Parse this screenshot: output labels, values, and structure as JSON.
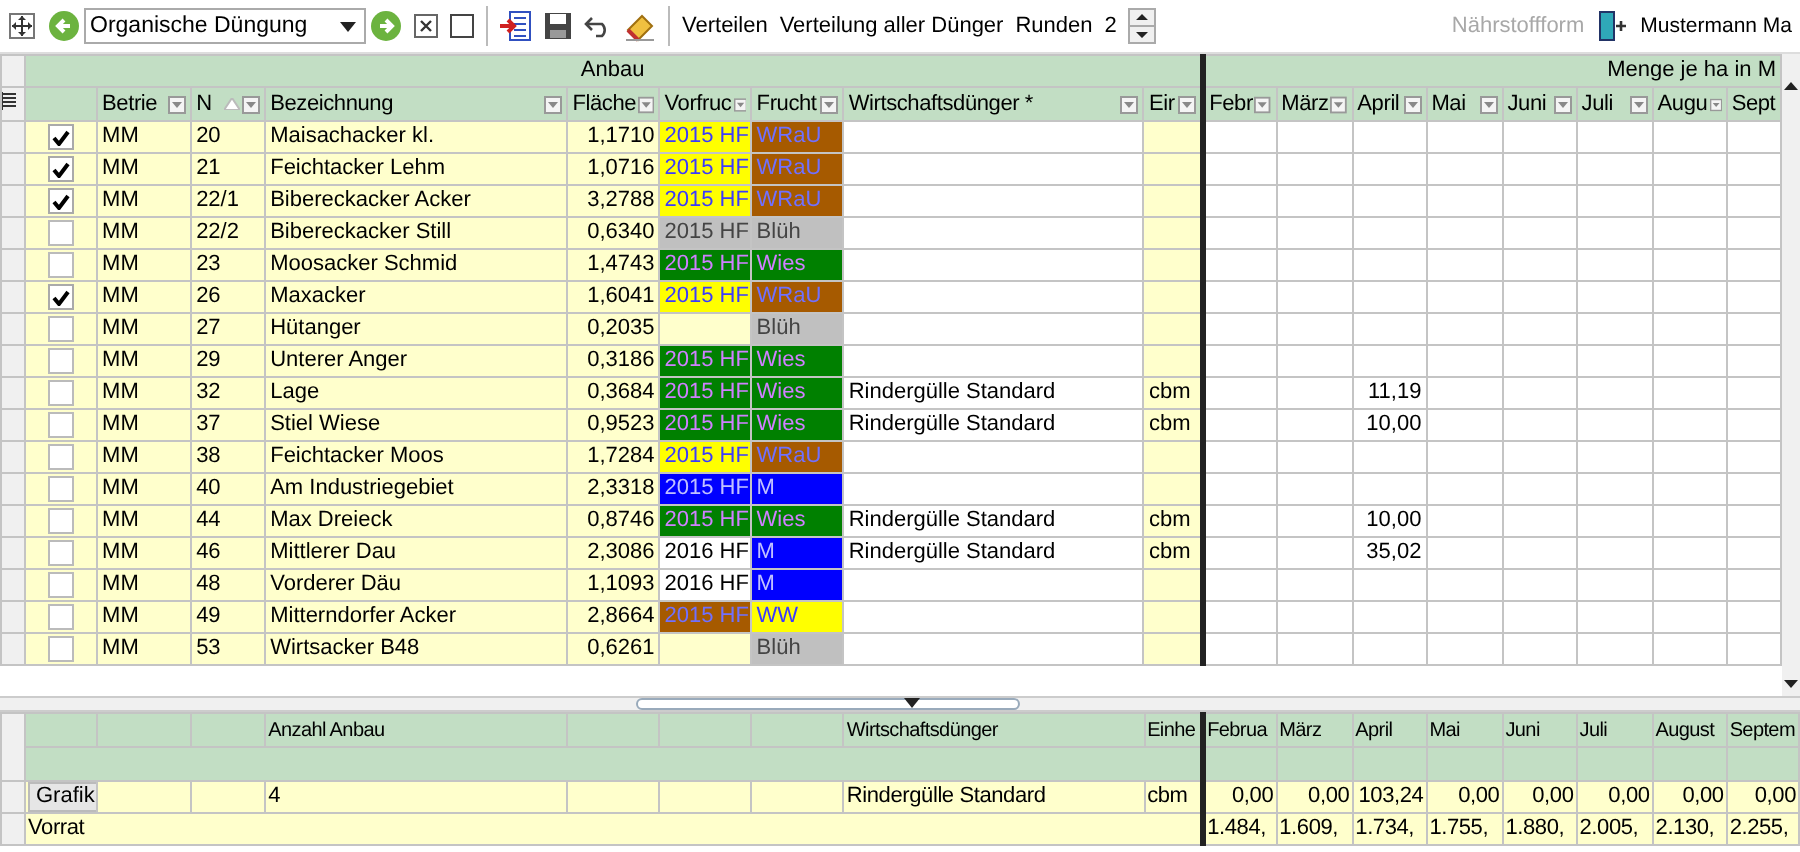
{
  "toolbar": {
    "dropdown": {
      "value": "Organische Düngung"
    },
    "actions": [
      "Verteilen",
      "Verteilung aller Dünger"
    ],
    "rounding": {
      "label": "Runden",
      "value": "2"
    },
    "nutrient_form": {
      "label": "Nährstoffform",
      "disabled": true
    },
    "user": "Mustermann Ma"
  },
  "grid": {
    "group_headers": [
      "Anbau",
      "Menge je ha in M"
    ],
    "columns": [
      {
        "label": "Betrie",
        "sorted": false
      },
      {
        "label": "N",
        "sorted": true
      },
      {
        "label": "Bezeichnung",
        "sorted": false
      },
      {
        "label": "Fläche",
        "sorted": false
      },
      {
        "label": "Vorfruc",
        "sorted": false
      },
      {
        "label": "Frucht",
        "sorted": false
      },
      {
        "label": "Wirtschaftsdünger *",
        "sorted": false
      },
      {
        "label": "Eir",
        "sorted": false
      }
    ],
    "month_columns": [
      "Febr",
      "März",
      "April",
      "Mai",
      "Juni",
      "Juli",
      "Augu",
      "Sept"
    ],
    "rows": [
      {
        "checked": true,
        "farm": "MM",
        "number": "20",
        "name": "Maisachacker kl.",
        "area": "1,1710",
        "previous_crop": {
          "text": "2015 HF",
          "color": "#ffff00"
        },
        "crop": {
          "text": "WRaU",
          "color": "#a65a00"
        }
      },
      {
        "checked": true,
        "farm": "MM",
        "number": "21",
        "name": "Feichtacker Lehm",
        "area": "1,0716",
        "previous_crop": {
          "text": "2015 HF",
          "color": "#ffff00"
        },
        "crop": {
          "text": "WRaU",
          "color": "#a65a00"
        }
      },
      {
        "checked": true,
        "farm": "MM",
        "number": "22/1",
        "name": "Bibereckacker Acker",
        "area": "3,2788",
        "previous_crop": {
          "text": "2015 HF",
          "color": "#ffff00"
        },
        "crop": {
          "text": "WRaU",
          "color": "#a65a00"
        }
      },
      {
        "checked": false,
        "farm": "MM",
        "number": "22/2",
        "name": "Bibereckacker Still",
        "area": "0,6340",
        "previous_crop": {
          "text": "2015 HF",
          "color": "#c0c0c0"
        },
        "crop": {
          "text": "Blüh",
          "color": "#c0c0c0"
        }
      },
      {
        "checked": false,
        "farm": "MM",
        "number": "23",
        "name": "Moosacker Schmid",
        "area": "1,4743",
        "previous_crop": {
          "text": "2015 HF",
          "color": "#008000"
        },
        "crop": {
          "text": "Wies",
          "color": "#008000"
        }
      },
      {
        "checked": true,
        "farm": "MM",
        "number": "26",
        "name": "Maxacker",
        "area": "1,6041",
        "previous_crop": {
          "text": "2015 HF",
          "color": "#ffff00"
        },
        "crop": {
          "text": "WRaU",
          "color": "#a65a00"
        }
      },
      {
        "checked": false,
        "farm": "MM",
        "number": "27",
        "name": "Hütanger",
        "area": "0,2035",
        "crop": {
          "text": "Blüh",
          "color": "#c0c0c0"
        }
      },
      {
        "checked": false,
        "farm": "MM",
        "number": "29",
        "name": "Unterer Anger",
        "area": "0,3186",
        "previous_crop": {
          "text": "2015 HF",
          "color": "#008000"
        },
        "crop": {
          "text": "Wies",
          "color": "#008000"
        }
      },
      {
        "checked": false,
        "farm": "MM",
        "number": "32",
        "name": "Lage",
        "area": "0,3684",
        "previous_crop": {
          "text": "2015 HF",
          "color": "#008000"
        },
        "crop": {
          "text": "Wies",
          "color": "#008000"
        },
        "fertilizer": "Rindergülle Standard",
        "unit": "cbm",
        "amounts": {
          "april": "11,19"
        }
      },
      {
        "checked": false,
        "farm": "MM",
        "number": "37",
        "name": "Stiel Wiese",
        "area": "0,9523",
        "previous_crop": {
          "text": "2015 HF",
          "color": "#008000"
        },
        "crop": {
          "text": "Wies",
          "color": "#008000"
        },
        "fertilizer": "Rindergülle Standard",
        "unit": "cbm",
        "amounts": {
          "april": "10,00"
        }
      },
      {
        "checked": false,
        "farm": "MM",
        "number": "38",
        "name": "Feichtacker Moos",
        "area": "1,7284",
        "previous_crop": {
          "text": "2015 HF",
          "color": "#ffff00"
        },
        "crop": {
          "text": "WRaU",
          "color": "#a65a00"
        }
      },
      {
        "checked": false,
        "farm": "MM",
        "number": "40",
        "name": "Am Industriegebiet",
        "area": "2,3318",
        "previous_crop": {
          "text": "2015 HF",
          "color": "#0000ff"
        },
        "crop": {
          "text": "M",
          "color": "#0000ff"
        }
      },
      {
        "checked": false,
        "farm": "MM",
        "number": "44",
        "name": "Max Dreieck",
        "area": "0,8746",
        "previous_crop": {
          "text": "2015 HF",
          "color": "#008000"
        },
        "crop": {
          "text": "Wies",
          "color": "#008000"
        },
        "fertilizer": "Rindergülle Standard",
        "unit": "cbm",
        "amounts": {
          "april": "10,00"
        }
      },
      {
        "checked": false,
        "farm": "MM",
        "number": "46",
        "name": "Mittlerer  Dau",
        "area": "2,3086",
        "previous_crop": {
          "text": "2016 HF"
        },
        "crop": {
          "text": "M",
          "color": "#0000ff"
        },
        "fertilizer": "Rindergülle Standard",
        "unit": "cbm",
        "amounts": {
          "april": "35,02"
        }
      },
      {
        "checked": false,
        "farm": "MM",
        "number": "48",
        "name": "Vorderer Däu",
        "area": "1,1093",
        "previous_crop": {
          "text": "2016 HF"
        },
        "crop": {
          "text": "M",
          "color": "#0000ff"
        }
      },
      {
        "checked": false,
        "farm": "MM",
        "number": "49",
        "name": "Mitterndorfer Acker",
        "area": "2,8664",
        "previous_crop": {
          "text": "2015 HF",
          "color": "#a65a00"
        },
        "crop": {
          "text": "WW",
          "color": "#ffff00"
        }
      },
      {
        "checked": false,
        "farm": "MM",
        "number": "53",
        "name": "Wirtsacker B48",
        "area": "0,6261",
        "crop": {
          "text": "Blüh",
          "color": "#c0c0c0"
        }
      }
    ]
  },
  "summary": {
    "header": {
      "count_label": "Anzahl Anbau",
      "fertilizer_label": "Wirtschaftsdünger",
      "unit_label": "Einhe",
      "months": [
        "Februa",
        "März",
        "April",
        "Mai",
        "Juni",
        "Juli",
        "August",
        "Septem"
      ]
    },
    "row": {
      "button": "Grafik",
      "count": "4",
      "fertilizer": "Rindergülle Standard",
      "unit": "cbm",
      "values": [
        "0,00",
        "0,00",
        "103,24",
        "0,00",
        "0,00",
        "0,00",
        "0,00",
        "0,00"
      ]
    },
    "stock": {
      "label": "Vorrat",
      "values": [
        "1.484,",
        "1.609,",
        "1.734,",
        "1.755,",
        "1.880,",
        "2.005,",
        "2.130,",
        "2.255,"
      ]
    }
  }
}
